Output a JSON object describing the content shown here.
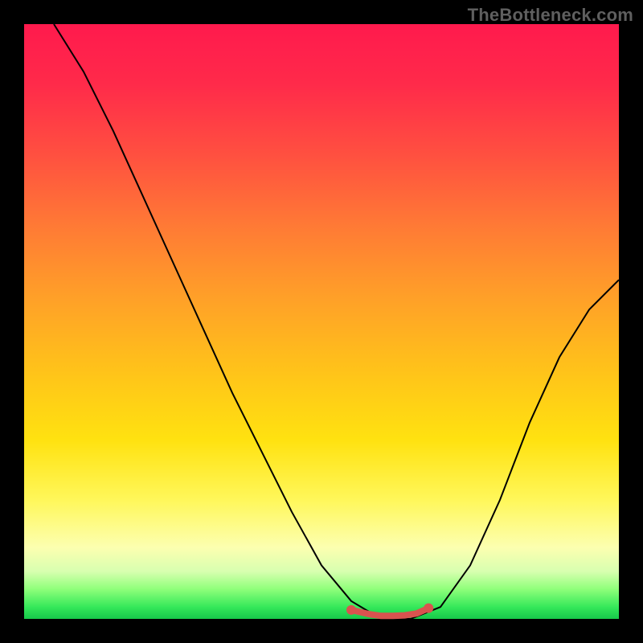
{
  "watermark": "TheBottleneck.com",
  "chart_data": {
    "type": "line",
    "title": "",
    "xlabel": "",
    "ylabel": "",
    "xlim": [
      0,
      100
    ],
    "ylim": [
      0,
      100
    ],
    "grid": false,
    "legend": false,
    "background_gradient": {
      "top_color": "#ff1a4d",
      "bottom_color": "#17c94a"
    },
    "series": [
      {
        "name": "bottleneck-curve",
        "color": "#000000",
        "x": [
          5,
          10,
          15,
          20,
          25,
          30,
          35,
          40,
          45,
          50,
          55,
          60,
          65,
          70,
          75,
          80,
          85,
          90,
          95,
          100
        ],
        "values": [
          100,
          92,
          82,
          71,
          60,
          49,
          38,
          28,
          18,
          9,
          3,
          0,
          0,
          2,
          9,
          20,
          33,
          44,
          52,
          57
        ]
      },
      {
        "name": "optimal-zone",
        "color": "#d9534f",
        "x": [
          55,
          58,
          60,
          62,
          64,
          66,
          68
        ],
        "values": [
          1.5,
          0.8,
          0.5,
          0.5,
          0.6,
          0.9,
          1.8
        ]
      }
    ],
    "markers": [
      {
        "name": "optimal-start",
        "x": 55,
        "y": 1.5,
        "color": "#d9534f"
      },
      {
        "name": "optimal-end",
        "x": 68,
        "y": 1.8,
        "color": "#d9534f"
      }
    ]
  }
}
